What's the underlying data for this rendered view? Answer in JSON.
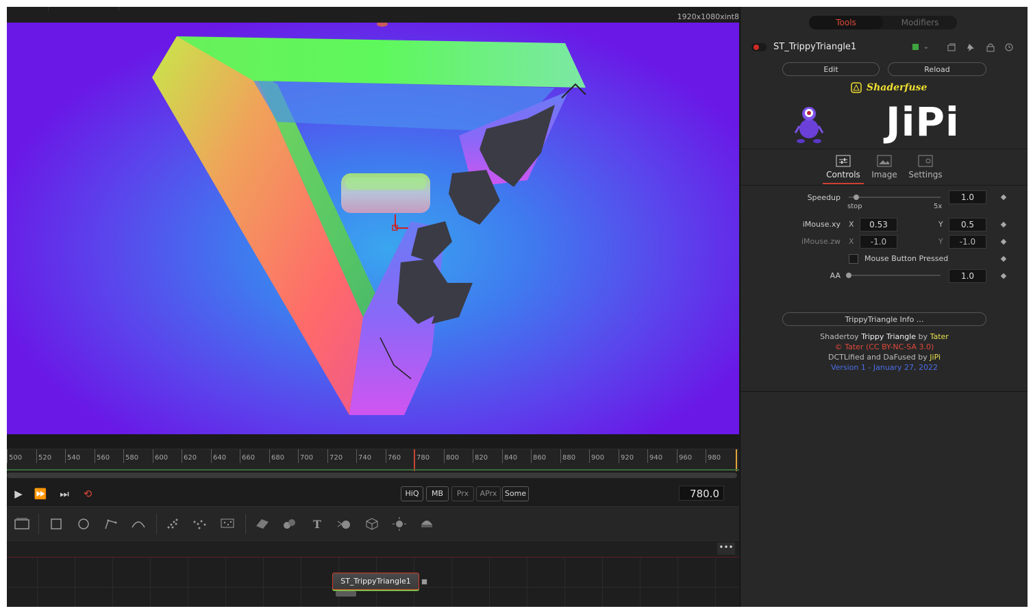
{
  "viewer": {
    "resolution": "1920x1080xint8"
  },
  "ruler": {
    "labels": [
      "500",
      "520",
      "540",
      "560",
      "580",
      "600",
      "620",
      "640",
      "660",
      "680",
      "700",
      "720",
      "740",
      "760",
      "780",
      "800",
      "820",
      "840",
      "860",
      "880",
      "900",
      "920",
      "940",
      "960",
      "980"
    ]
  },
  "transport": {
    "play_icon": "play-icon",
    "fast_forward_icon": "fast-forward-icon",
    "skip_end_icon": "skip-to-end-icon",
    "loop_icon": "loop-icon",
    "quality_buttons": [
      "HiQ",
      "MB",
      "Prx",
      "APrx",
      "Some"
    ],
    "current_frame": "780.0"
  },
  "toolbar": {
    "icons": [
      "background-icon",
      "rectangle-mask-icon",
      "ellipse-mask-icon",
      "polygon-mask-icon",
      "bspline-mask-icon",
      "particle-emitter-icon",
      "particle-render-icon",
      "particle-style-icon",
      "shape-3d-icon",
      "merge-3d-icon",
      "text-3d-icon",
      "renderer-3d-icon",
      "image-plane-icon",
      "fog-3d-icon",
      "camera-3d-icon"
    ]
  },
  "flow": {
    "more_label": "•••",
    "node_name": "ST_TrippyTriangle1"
  },
  "inspector": {
    "tabs": {
      "tools": "Tools",
      "modifiers": "Modifiers"
    },
    "node_title": "ST_TrippyTriangle1",
    "edit_label": "Edit",
    "reload_label": "Reload",
    "shaderfuse_label": "Shaderfuse",
    "brand_label": "JiPi",
    "subtabs": {
      "controls": "Controls",
      "image": "Image",
      "settings": "Settings"
    },
    "params": {
      "speedup_label": "Speedup",
      "speedup_value": "1.0",
      "speedup_min": "stop",
      "speedup_max": "5x",
      "speedup_level": 0.08,
      "imouse_xy_label": "iMouse.xy",
      "imouse_x_label": "X",
      "imouse_x": "0.53",
      "imouse_y_label": "Y",
      "imouse_y": "0.5",
      "imouse_zw_label": "iMouse.zw",
      "imouse_z_label": "X",
      "imouse_z": "-1.0",
      "imouse_w_label": "Y",
      "imouse_w": "-1.0",
      "mouse_button_label": "Mouse Button Pressed",
      "mouse_button_checked": false,
      "aa_label": "AA",
      "aa_value": "1.0",
      "aa_level": 0.0
    },
    "info_button": "TrippyTriangle Info ...",
    "credits": {
      "line1_a": "Shadertoy ",
      "line1_b": "Trippy Triangle",
      "line1_c": " by ",
      "line1_d": "Tater",
      "line2": "© Tater (CC BY-NC-SA 3.0)",
      "line3_a": "DCTLified and DaFused by ",
      "line3_b": "JiPi",
      "line4": "Version 1 - January 27, 2022"
    },
    "colors": {
      "accent": "#d0402f",
      "yellow": "#e8e050",
      "credit_red": "#e0483a",
      "version_blue": "#4a6de8",
      "node_color": "#3fa43f"
    }
  }
}
